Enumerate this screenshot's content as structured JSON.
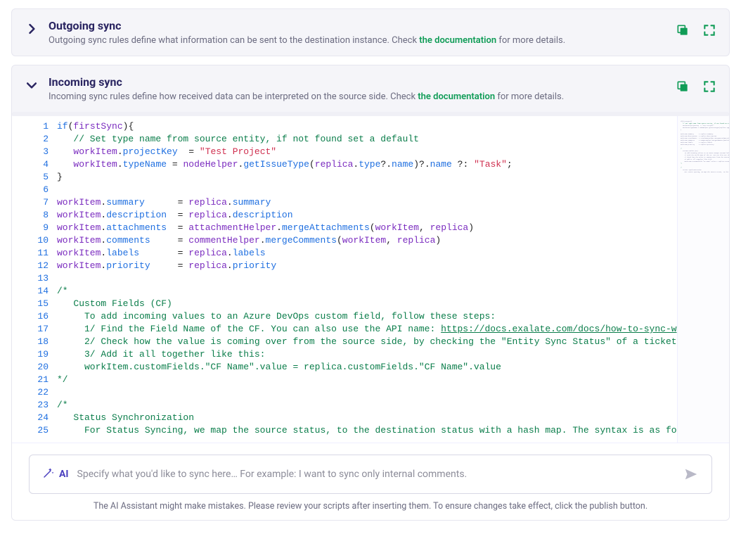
{
  "outgoing": {
    "title": "Outgoing sync",
    "desc_pre": "Outgoing sync rules define what information can be sent to the destination instance. Check ",
    "desc_link": "the documentation",
    "desc_post": " for more details."
  },
  "incoming": {
    "title": "Incoming sync",
    "desc_pre": "Incoming sync rules define how received data can be interpreted on the source side. Check ",
    "desc_link": "the documentation",
    "desc_post": " for more details.",
    "lines": [
      {
        "n": 1,
        "html": "<span class='tok-k'>if</span><span class='tok-o'>(</span><span class='tok-v'>firstSync</span><span class='tok-o'>){</span>"
      },
      {
        "n": 2,
        "html": "   <span class='tok-c'>// Set type name from source entity, if not found set a default</span>"
      },
      {
        "n": 3,
        "html": "   <span class='tok-v'>workItem</span><span class='tok-o'>.</span><span class='tok-m'>projectKey</span>  <span class='tok-o'>=</span> <span class='tok-s'>\"Test Project\"</span>"
      },
      {
        "n": 4,
        "html": "   <span class='tok-v'>workItem</span><span class='tok-o'>.</span><span class='tok-m'>typeName</span> <span class='tok-o'>=</span> <span class='tok-v'>nodeHelper</span><span class='tok-o'>.</span><span class='tok-f'>getIssueType</span><span class='tok-o'>(</span><span class='tok-v'>replica</span><span class='tok-o'>.</span><span class='tok-m'>type</span><span class='tok-o'>?.</span><span class='tok-m'>name</span><span class='tok-o'>)?.</span><span class='tok-m'>name</span> <span class='tok-o'>?:</span> <span class='tok-s'>\"Task\"</span><span class='tok-o'>;</span>"
      },
      {
        "n": 5,
        "html": "<span class='tok-o'>}</span>"
      },
      {
        "n": 6,
        "html": ""
      },
      {
        "n": 7,
        "html": "<span class='tok-v'>workItem</span><span class='tok-o'>.</span><span class='tok-m'>summary</span>      <span class='tok-o'>=</span> <span class='tok-v'>replica</span><span class='tok-o'>.</span><span class='tok-m'>summary</span>"
      },
      {
        "n": 8,
        "html": "<span class='tok-v'>workItem</span><span class='tok-o'>.</span><span class='tok-m'>description</span>  <span class='tok-o'>=</span> <span class='tok-v'>replica</span><span class='tok-o'>.</span><span class='tok-m'>description</span>"
      },
      {
        "n": 9,
        "html": "<span class='tok-v'>workItem</span><span class='tok-o'>.</span><span class='tok-m'>attachments</span>  <span class='tok-o'>=</span> <span class='tok-v'>attachmentHelper</span><span class='tok-o'>.</span><span class='tok-f'>mergeAttachments</span><span class='tok-o'>(</span><span class='tok-v'>workItem</span><span class='tok-o'>, </span><span class='tok-v'>replica</span><span class='tok-o'>)</span>"
      },
      {
        "n": 10,
        "html": "<span class='tok-v'>workItem</span><span class='tok-o'>.</span><span class='tok-m'>comments</span>     <span class='tok-o'>=</span> <span class='tok-v'>commentHelper</span><span class='tok-o'>.</span><span class='tok-f'>mergeComments</span><span class='tok-o'>(</span><span class='tok-v'>workItem</span><span class='tok-o'>, </span><span class='tok-v'>replica</span><span class='tok-o'>)</span>"
      },
      {
        "n": 11,
        "html": "<span class='tok-v'>workItem</span><span class='tok-o'>.</span><span class='tok-m'>labels</span>       <span class='tok-o'>=</span> <span class='tok-v'>replica</span><span class='tok-o'>.</span><span class='tok-m'>labels</span>"
      },
      {
        "n": 12,
        "html": "<span class='tok-v'>workItem</span><span class='tok-o'>.</span><span class='tok-m'>priority</span>     <span class='tok-o'>=</span> <span class='tok-v'>replica</span><span class='tok-o'>.</span><span class='tok-m'>priority</span>"
      },
      {
        "n": 13,
        "html": ""
      },
      {
        "n": 14,
        "html": "<span class='tok-c'>/*</span>"
      },
      {
        "n": 15,
        "html": "<span class='tok-c'>   Custom Fields (CF)</span>"
      },
      {
        "n": 16,
        "html": "<span class='tok-c'>     To add incoming values to an Azure DevOps custom field, follow these steps:</span>"
      },
      {
        "n": 17,
        "html": "<span class='tok-c'>     1/ Find the Field Name of the CF. You can also use the API name: </span><span class='tok-c tok-u'>https://docs.exalate.com/docs/how-to-sync-w</span>"
      },
      {
        "n": 18,
        "html": "<span class='tok-c'>     2/ Check how the value is coming over from the source side, by checking the \"Entity Sync Status\" of a ticket</span>"
      },
      {
        "n": 19,
        "html": "<span class='tok-c'>     3/ Add it all together like this:</span>"
      },
      {
        "n": 20,
        "html": "<span class='tok-c'>     workItem.customFields.\"CF Name\".value = replica.customFields.\"CF Name\".value</span>"
      },
      {
        "n": 21,
        "html": "<span class='tok-c'>*/</span>"
      },
      {
        "n": 22,
        "html": ""
      },
      {
        "n": 23,
        "html": "<span class='tok-c'>/*</span>"
      },
      {
        "n": 24,
        "html": "<span class='tok-c'>   Status Synchronization</span>"
      },
      {
        "n": 25,
        "html": "<span class='tok-c'>     For Status Syncing, we map the source status, to the destination status with a hash map. The syntax is as fo</span>"
      }
    ]
  },
  "ai": {
    "badge": "AI",
    "placeholder": "Specify what you'd like to sync here…  For example: I want to sync only internal comments.",
    "note": "The AI Assistant might make mistakes. Please review your scripts after inserting them. To ensure changes take effect, click the publish button."
  },
  "icons": {
    "copy": "copy-icon",
    "fullscreen": "fullscreen-icon",
    "wand": "wand-icon",
    "send": "send-icon"
  }
}
